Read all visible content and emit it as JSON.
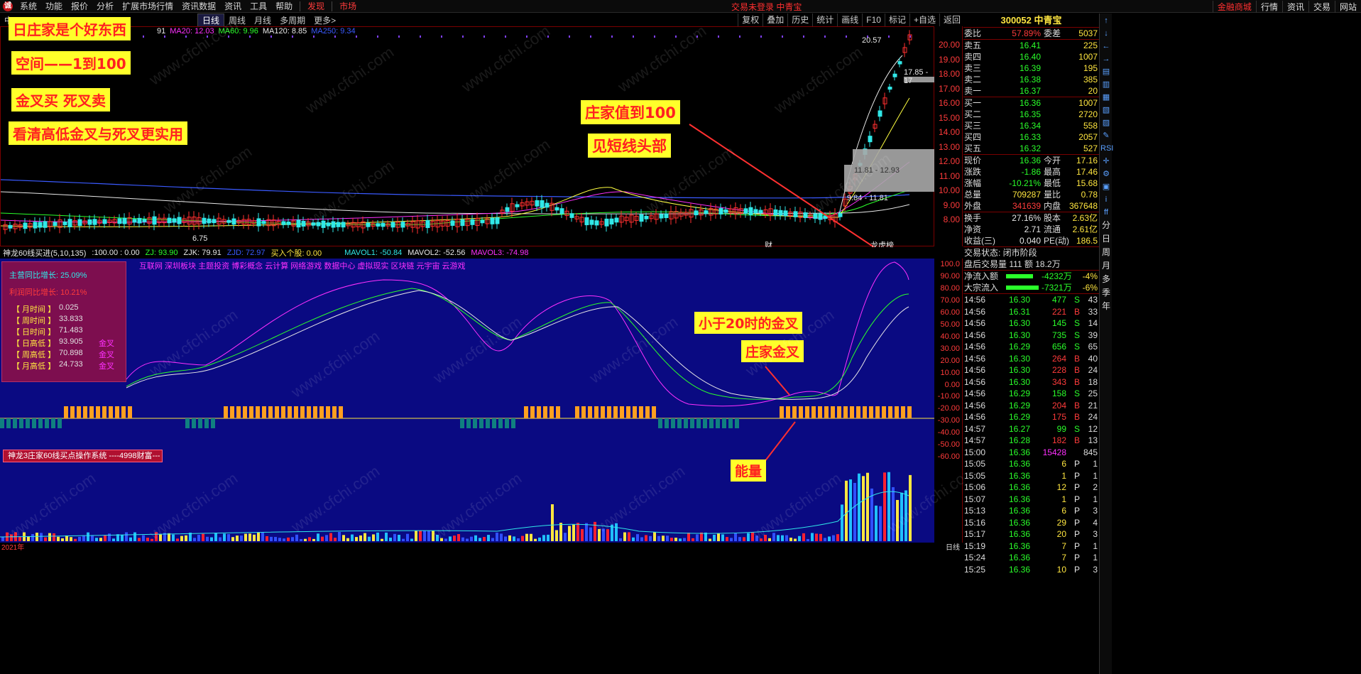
{
  "menu": {
    "items": [
      "系统",
      "功能",
      "报价",
      "分析",
      "扩展市场行情",
      "资讯数据",
      "资讯",
      "工具",
      "帮助"
    ],
    "red_items": [
      "发现",
      "市场"
    ],
    "center_text": "交易未登录 中青宝",
    "right_buttons": [
      "金融商城",
      "行情",
      "资讯",
      "交易",
      "网站"
    ]
  },
  "toolbar": {
    "left_text": "中",
    "period_active": "日线",
    "periods": [
      "周线",
      "月线",
      "多周期",
      "更多>"
    ],
    "right_buttons": [
      "复权",
      "叠加",
      "历史",
      "统计",
      "画线",
      "F10",
      "标记",
      "+自选",
      "返回"
    ]
  },
  "ma_legend": [
    {
      "text": "91",
      "color": "#e8e8e8"
    },
    {
      "text": "MA20: 12.03",
      "color": "#ff30ff"
    },
    {
      "text": "MA60: 9.96",
      "color": "#2aff2a"
    },
    {
      "text": "MA120: 8.85",
      "color": "#e8e8e8"
    },
    {
      "text": "MA250: 9.34",
      "color": "#3a5aff"
    }
  ],
  "annotations": {
    "title": "日庄家是个好东西",
    "space": "空间——1到100",
    "golden": "金叉买   死叉卖",
    "watch": "看清高低金叉与死叉更实用",
    "top": "庄家值到100",
    "short_top": "见短线头部",
    "under20": "小于20时的金叉",
    "zhuang_golden": "庄家金叉",
    "energy": "能量"
  },
  "chart_labels": {
    "high": "20.57",
    "right_range": "17.85 - 17",
    "box1": "11.81 - 12.93",
    "box2": "9.84 - 11.81",
    "low": "6.75",
    "cai": "财",
    "bang": "龙虎榜"
  },
  "price_ticks": [
    "20.00",
    "19.00",
    "18.00",
    "17.00",
    "16.00",
    "15.00",
    "14.00",
    "13.00",
    "12.00",
    "11.00",
    "10.00",
    "9.00",
    "8.00"
  ],
  "indicator": {
    "name": "神龙60线买进(5,10,135)",
    "v1": ":100.00 : 0.00",
    "zj": "ZJ: 93.90",
    "zjk": "ZJK: 79.91",
    "zjd": "ZJD: 72.97",
    "buy": "买入个股: 0.00",
    "mavol1": "MAVOL1: -50.84",
    "mavol2": "MAVOL2: -52.56",
    "mavol3": "MAVOL3: -74.98"
  },
  "concepts": "互联网 深圳板块 主题投资 博彩概念 云计算 网络游戏 数据中心 虚拟现实 区块链 元宇宙 云游戏",
  "info_box": {
    "l1k": "主营同比增长:",
    "l1v": "25.09%",
    "l2k": "利润同比增长:",
    "l2v": "10.21%",
    "rows": [
      {
        "k": "【 月时间 】",
        "v": "0.025",
        "f": ""
      },
      {
        "k": "【 周时间 】",
        "v": "33.833",
        "f": ""
      },
      {
        "k": "【 日时间 】",
        "v": "71.483",
        "f": ""
      },
      {
        "k": "【 日高低 】",
        "v": "93.905",
        "f": "金叉"
      },
      {
        "k": "【 周高低 】",
        "v": "70.898",
        "f": "金叉"
      },
      {
        "k": "【 月高低 】",
        "v": "24.733",
        "f": "金叉"
      }
    ]
  },
  "bottom_button": "神龙3庄家60线买点操作系统 ----4998财富---",
  "sub_ticks": [
    "100.0",
    "90.00",
    "80.00",
    "70.00",
    "60.00",
    "50.00",
    "40.00",
    "30.00",
    "20.00",
    "10.00",
    "0.00",
    "-10.00",
    "-20.00",
    "-30.00",
    "-40.00",
    "-50.00",
    "-60.00"
  ],
  "time_axis": {
    "year": "2021年",
    "last": "日线"
  },
  "watermark": "www.cfchi.com",
  "quote": {
    "code": "300052",
    "name": "中青宝",
    "weibi": {
      "l": "委比",
      "v": "57.89%",
      "l2": "委差",
      "v2": "5037"
    },
    "asks": [
      {
        "l": "卖五",
        "p": "16.41",
        "q": "225"
      },
      {
        "l": "卖四",
        "p": "16.40",
        "q": "1007"
      },
      {
        "l": "卖三",
        "p": "16.39",
        "q": "195"
      },
      {
        "l": "卖二",
        "p": "16.38",
        "q": "385"
      },
      {
        "l": "卖一",
        "p": "16.37",
        "q": "20"
      }
    ],
    "bids": [
      {
        "l": "买一",
        "p": "16.36",
        "q": "1007"
      },
      {
        "l": "买二",
        "p": "16.35",
        "q": "2720"
      },
      {
        "l": "买三",
        "p": "16.34",
        "q": "558"
      },
      {
        "l": "买四",
        "p": "16.33",
        "q": "2057"
      },
      {
        "l": "买五",
        "p": "16.32",
        "q": "527"
      }
    ],
    "stats": [
      {
        "l": "现价",
        "v": "16.36",
        "vc": "green",
        "l2": "今开",
        "v2": "17.16",
        "v2c": "red"
      },
      {
        "l": "涨跌",
        "v": "-1.86",
        "vc": "green",
        "l2": "最高",
        "v2": "17.46",
        "v2c": "red"
      },
      {
        "l": "涨幅",
        "v": "-10.21%",
        "vc": "green",
        "l2": "最低",
        "v2": "15.68",
        "v2c": "green"
      },
      {
        "l": "总量",
        "v": "709287",
        "vc": "yellow",
        "l2": "量比",
        "v2": "0.78",
        "v2c": "yellow"
      },
      {
        "l": "外盘",
        "v": "341639",
        "vc": "red",
        "l2": "内盘",
        "v2": "367648",
        "v2c": "green"
      }
    ],
    "stats2": [
      {
        "l": "换手",
        "v": "27.16%",
        "vc": "white",
        "l2": "股本",
        "v2": "2.63亿",
        "v2c": "white"
      },
      {
        "l": "净资",
        "v": "2.71",
        "vc": "white",
        "l2": "流通",
        "v2": "2.61亿",
        "v2c": "white"
      },
      {
        "l": "收益(三)",
        "v": "0.040",
        "vc": "white",
        "l2": "PE(动)",
        "v2": "186.5",
        "v2c": "white"
      }
    ],
    "status": "交易状态: 闭市阶段",
    "after": "盘后交易量 111 额 18.2万",
    "flows": [
      {
        "l": "净流入额",
        "v": "-4232万",
        "p": "-4%"
      },
      {
        "l": "大宗流入",
        "v": "-7321万",
        "p": "-6%"
      }
    ],
    "ticks": [
      {
        "t": "14:56",
        "p": "16.30",
        "v": "477",
        "s": "S",
        "n": "43"
      },
      {
        "t": "14:56",
        "p": "16.31",
        "v": "221",
        "s": "B",
        "n": "33"
      },
      {
        "t": "14:56",
        "p": "16.30",
        "v": "145",
        "s": "S",
        "n": "14"
      },
      {
        "t": "14:56",
        "p": "16.30",
        "v": "735",
        "s": "S",
        "n": "39"
      },
      {
        "t": "14:56",
        "p": "16.29",
        "v": "656",
        "s": "S",
        "n": "65"
      },
      {
        "t": "14:56",
        "p": "16.30",
        "v": "264",
        "s": "B",
        "n": "40"
      },
      {
        "t": "14:56",
        "p": "16.30",
        "v": "228",
        "s": "B",
        "n": "24"
      },
      {
        "t": "14:56",
        "p": "16.30",
        "v": "343",
        "s": "B",
        "n": "18"
      },
      {
        "t": "14:56",
        "p": "16.29",
        "v": "158",
        "s": "S",
        "n": "25"
      },
      {
        "t": "14:56",
        "p": "16.29",
        "v": "204",
        "s": "B",
        "n": "21"
      },
      {
        "t": "14:56",
        "p": "16.29",
        "v": "175",
        "s": "B",
        "n": "24"
      },
      {
        "t": "14:57",
        "p": "16.27",
        "v": "99",
        "s": "S",
        "n": "12"
      },
      {
        "t": "14:57",
        "p": "16.28",
        "v": "182",
        "s": "B",
        "n": "13"
      },
      {
        "t": "15:00",
        "p": "16.36",
        "v": "15428",
        "s": "",
        "n": "845"
      },
      {
        "t": "15:05",
        "p": "16.36",
        "v": "6",
        "s": "P",
        "n": "1"
      },
      {
        "t": "15:05",
        "p": "16.36",
        "v": "1",
        "s": "P",
        "n": "1"
      },
      {
        "t": "15:06",
        "p": "16.36",
        "v": "12",
        "s": "P",
        "n": "2"
      },
      {
        "t": "15:07",
        "p": "16.36",
        "v": "1",
        "s": "P",
        "n": "1"
      },
      {
        "t": "15:13",
        "p": "16.36",
        "v": "6",
        "s": "P",
        "n": "3"
      },
      {
        "t": "15:16",
        "p": "16.36",
        "v": "29",
        "s": "P",
        "n": "4"
      },
      {
        "t": "15:17",
        "p": "16.36",
        "v": "20",
        "s": "P",
        "n": "3"
      },
      {
        "t": "15:19",
        "p": "16.36",
        "v": "7",
        "s": "P",
        "n": "1"
      },
      {
        "t": "15:24",
        "p": "16.36",
        "v": "7",
        "s": "P",
        "n": "1"
      },
      {
        "t": "15:25",
        "p": "16.36",
        "v": "10",
        "s": "P",
        "n": "3"
      }
    ]
  },
  "sidebar": {
    "icons": [
      "up-arrow-icon",
      "down-arrow-icon",
      "left-arrow-icon",
      "right-arrow-icon",
      "chart-icon",
      "chart2-icon",
      "chart3-icon",
      "grid-icon",
      "list-icon",
      "pen-icon",
      "rsi-icon",
      "cross-icon",
      "gear-icon",
      "layout-icon",
      "info-icon",
      "ff-icon"
    ],
    "icon_labels": [
      "↑",
      "↓",
      "←",
      "→",
      "▤",
      "▥",
      "▦",
      "▧",
      "▨",
      "✎",
      "RSI",
      "✛",
      "⚙",
      "▣",
      "i",
      "ff"
    ],
    "labels": [
      "分",
      "日",
      "周",
      "月",
      "多",
      "季",
      "年"
    ]
  }
}
